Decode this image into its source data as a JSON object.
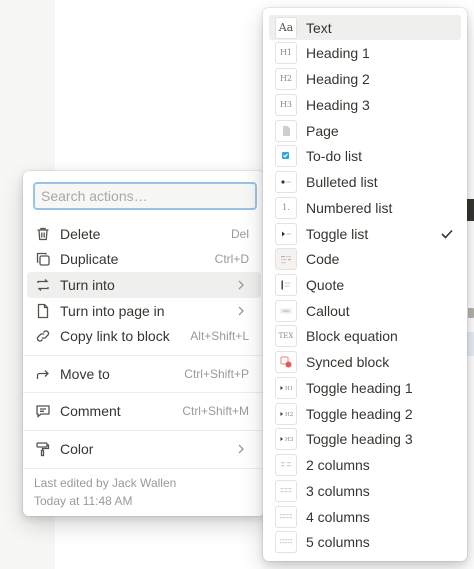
{
  "actions_menu": {
    "search": {
      "placeholder": "Search actions…",
      "value": ""
    },
    "items": [
      {
        "label": "Delete",
        "shortcut": "Del",
        "icon": "trash-icon"
      },
      {
        "label": "Duplicate",
        "shortcut": "Ctrl+D",
        "icon": "duplicate-icon"
      },
      {
        "label": "Turn into",
        "shortcut": "",
        "icon": "turn-into-icon",
        "submenu": true,
        "highlighted": true
      },
      {
        "label": "Turn into page in",
        "shortcut": "",
        "icon": "page-icon",
        "submenu": true
      },
      {
        "label": "Copy link to block",
        "shortcut": "Alt+Shift+L",
        "icon": "link-icon"
      },
      {
        "label": "Move to",
        "shortcut": "Ctrl+Shift+P",
        "icon": "arrow-right-icon"
      },
      {
        "label": "Comment",
        "shortcut": "Ctrl+Shift+M",
        "icon": "comment-icon"
      },
      {
        "label": "Color",
        "shortcut": "",
        "icon": "paint-roller-icon",
        "submenu": true
      }
    ],
    "footer": {
      "edited_by": "Last edited by Jack Wallen",
      "edited_time": "Today at 11:48 AM"
    }
  },
  "types_menu": {
    "items": [
      {
        "label": "Text",
        "thumb": "Aa",
        "icon": "text-block-icon",
        "highlighted": true
      },
      {
        "label": "Heading 1",
        "thumb": "H1",
        "icon": "heading-1-icon"
      },
      {
        "label": "Heading 2",
        "thumb": "H2",
        "icon": "heading-2-icon"
      },
      {
        "label": "Heading 3",
        "thumb": "H3",
        "icon": "heading-3-icon"
      },
      {
        "label": "Page",
        "thumb": "",
        "icon": "page-block-icon"
      },
      {
        "label": "To-do list",
        "thumb": "",
        "icon": "todo-list-icon"
      },
      {
        "label": "Bulleted list",
        "thumb": "",
        "icon": "bulleted-list-icon"
      },
      {
        "label": "Numbered list",
        "thumb": "1.",
        "icon": "numbered-list-icon"
      },
      {
        "label": "Toggle list",
        "thumb": "",
        "icon": "toggle-list-icon",
        "checked": true
      },
      {
        "label": "Code",
        "thumb": "",
        "icon": "code-block-icon"
      },
      {
        "label": "Quote",
        "thumb": "",
        "icon": "quote-block-icon"
      },
      {
        "label": "Callout",
        "thumb": "",
        "icon": "callout-block-icon"
      },
      {
        "label": "Block equation",
        "thumb": "TEX",
        "icon": "equation-block-icon"
      },
      {
        "label": "Synced block",
        "thumb": "",
        "icon": "synced-block-icon"
      },
      {
        "label": "Toggle heading 1",
        "thumb": "H1",
        "icon": "toggle-heading-1-icon"
      },
      {
        "label": "Toggle heading 2",
        "thumb": "H2",
        "icon": "toggle-heading-2-icon"
      },
      {
        "label": "Toggle heading 3",
        "thumb": "H3",
        "icon": "toggle-heading-3-icon"
      },
      {
        "label": "2 columns",
        "thumb": "",
        "icon": "two-columns-icon"
      },
      {
        "label": "3 columns",
        "thumb": "",
        "icon": "three-columns-icon"
      },
      {
        "label": "4 columns",
        "thumb": "",
        "icon": "four-columns-icon"
      },
      {
        "label": "5 columns",
        "thumb": "",
        "icon": "five-columns-icon"
      }
    ]
  },
  "colors": {
    "highlight": "#efefee",
    "search_border": "#9bc3e6",
    "accent_blue": "#2eaadc",
    "synced_red": "#eb5757"
  }
}
